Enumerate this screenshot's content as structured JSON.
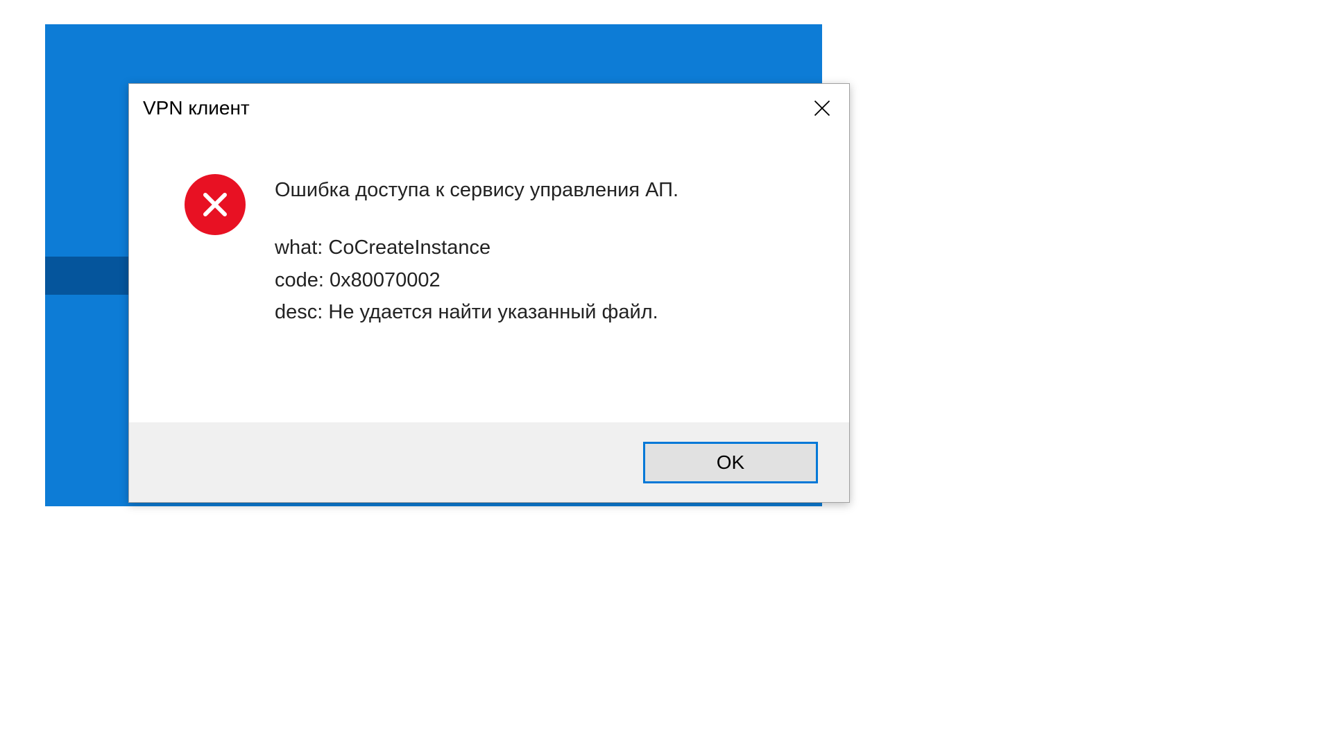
{
  "dialog": {
    "title": "VPN клиент",
    "message_heading": "Ошибка доступа к сервису управления АП.",
    "detail_what": "what: CoCreateInstance",
    "detail_code": "code: 0x80070002",
    "detail_desc": "desc: Не удается найти указанный файл.",
    "ok_label": "OK"
  },
  "colors": {
    "desktop_bg": "#0d7cd6",
    "desktop_dark_bar": "#05559c",
    "error_icon_bg": "#e81123",
    "button_border": "#0078d7",
    "footer_bg": "#f0f0f0"
  }
}
